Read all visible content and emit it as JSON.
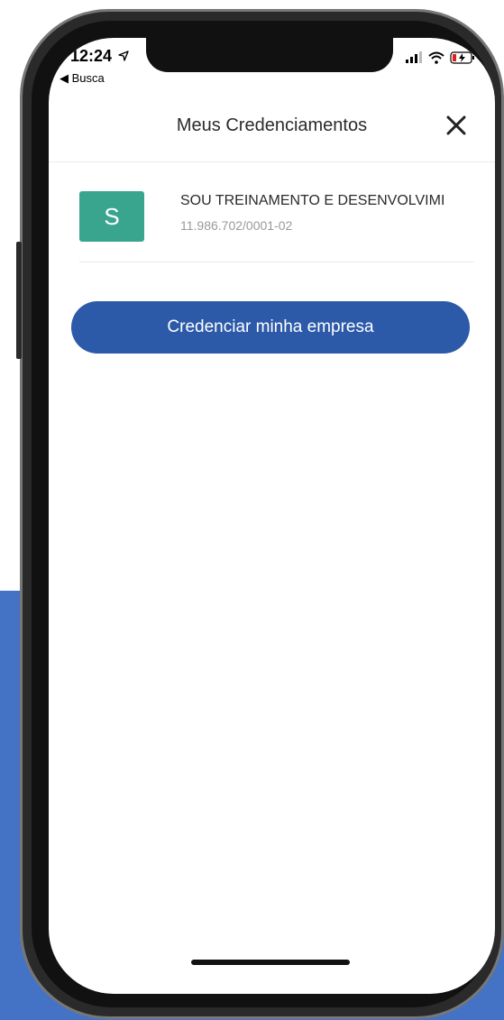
{
  "status_bar": {
    "time": "12:24",
    "back_label": "◀ Busca"
  },
  "header": {
    "title": "Meus Credenciamentos"
  },
  "companies": [
    {
      "initial": "S",
      "name": "SOU TREINAMENTO E DESENVOLVIMI",
      "cnpj": "11.986.702/0001-02",
      "avatar_color": "#3aa58f"
    }
  ],
  "actions": {
    "register_label": "Credenciar minha empresa"
  },
  "colors": {
    "primary": "#2c5aa8",
    "background_panel": "#4472c4"
  }
}
